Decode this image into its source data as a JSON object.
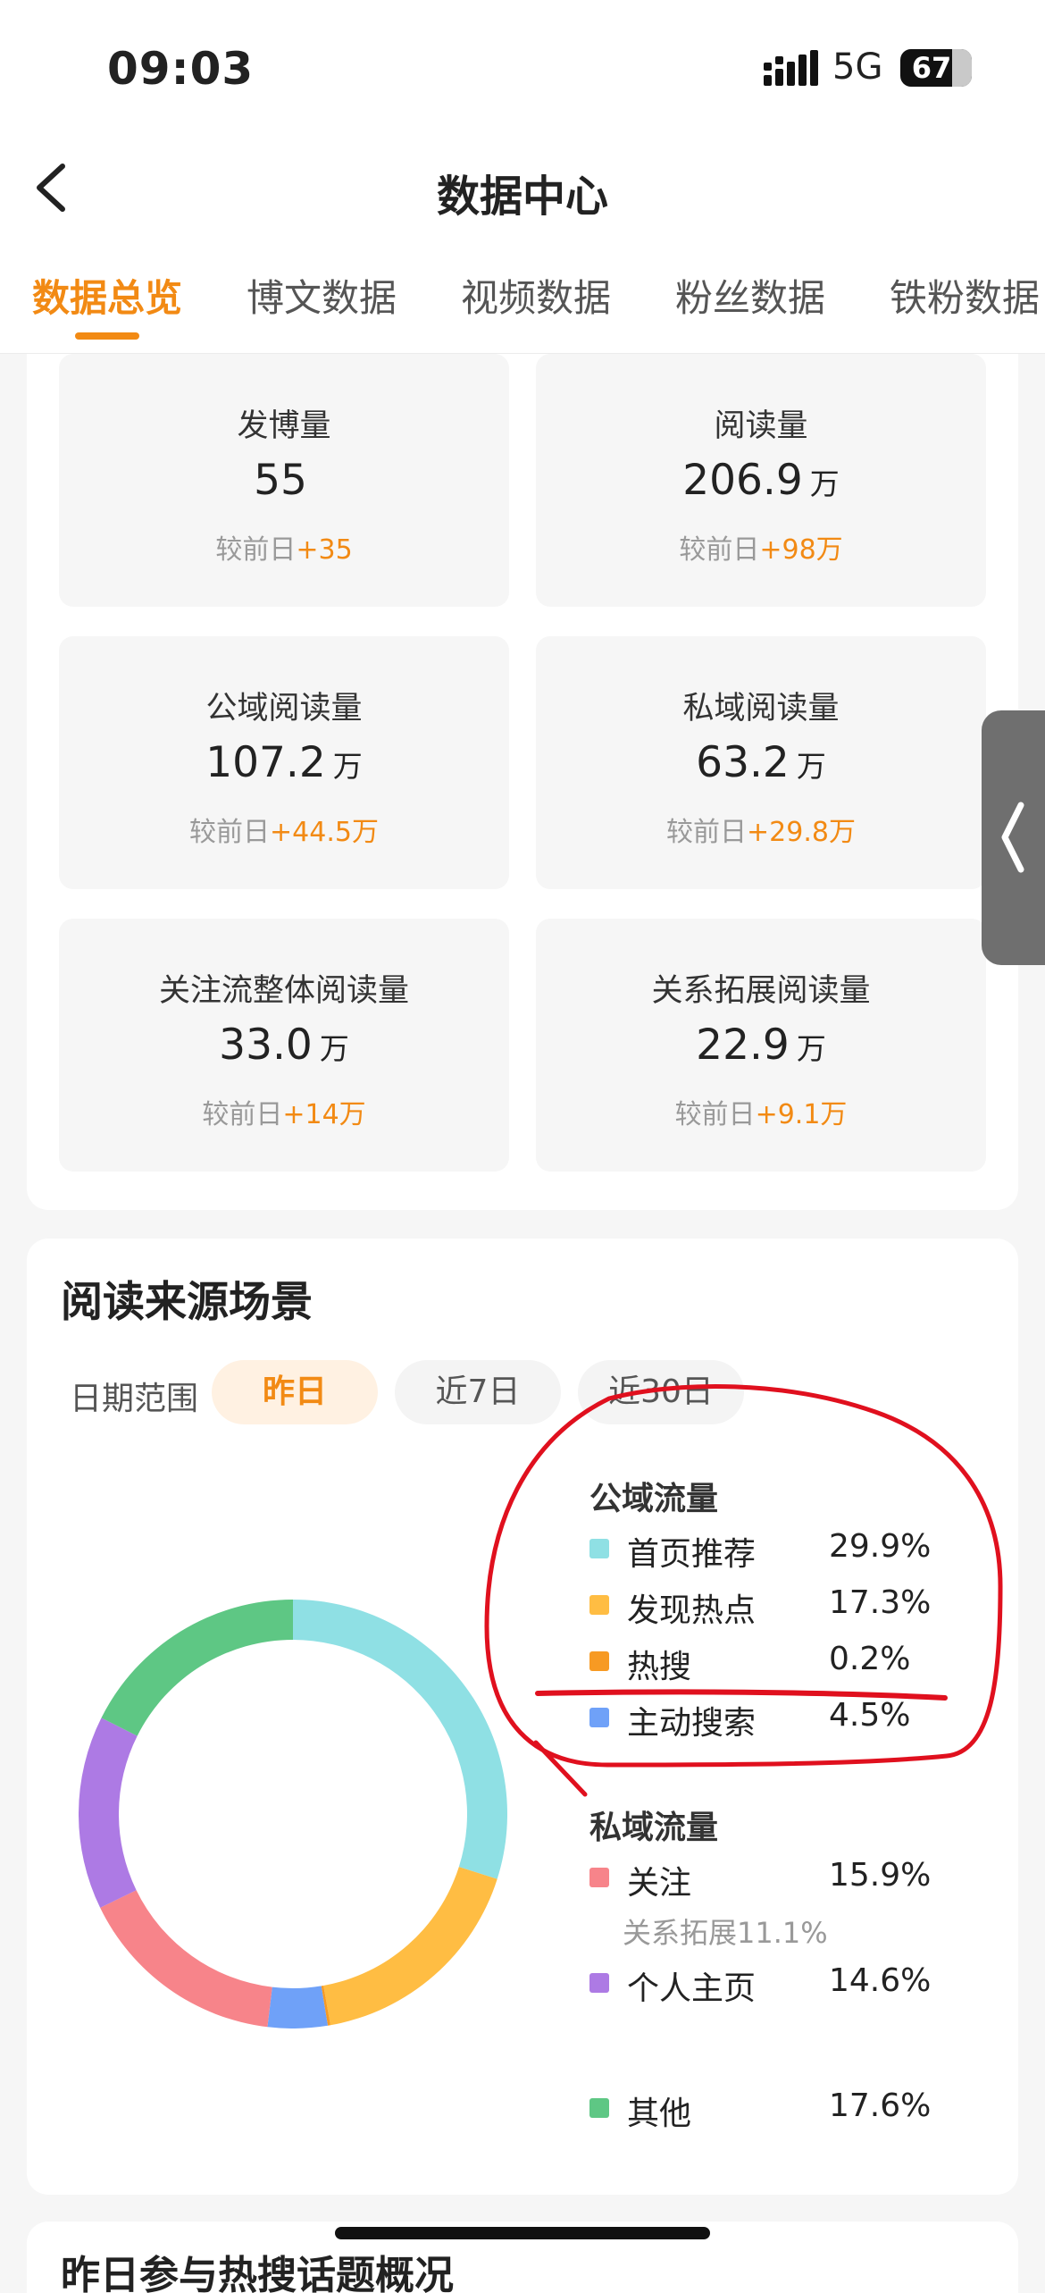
{
  "status_bar": {
    "time": "09:03",
    "network": "5G",
    "battery": "67"
  },
  "header": {
    "title": "数据中心",
    "tabs": [
      {
        "label": "数据总览",
        "active": true
      },
      {
        "label": "博文数据",
        "active": false
      },
      {
        "label": "视频数据",
        "active": false
      },
      {
        "label": "粉丝数据",
        "active": false
      },
      {
        "label": "铁粉数据",
        "active": false
      }
    ]
  },
  "stats": [
    {
      "label": "发博量",
      "value": "55",
      "unit": "",
      "delta_prefix": "较前日",
      "delta": "+35"
    },
    {
      "label": "阅读量",
      "value": "206.9",
      "unit": "万",
      "delta_prefix": "较前日",
      "delta": "+98万"
    },
    {
      "label": "公域阅读量",
      "value": "107.2",
      "unit": "万",
      "delta_prefix": "较前日",
      "delta": "+44.5万"
    },
    {
      "label": "私域阅读量",
      "value": "63.2",
      "unit": "万",
      "delta_prefix": "较前日",
      "delta": "+29.8万"
    },
    {
      "label": "关注流整体阅读量",
      "value": "33.0",
      "unit": "万",
      "delta_prefix": "较前日",
      "delta": "+14万"
    },
    {
      "label": "关系拓展阅读量",
      "value": "22.9",
      "unit": "万",
      "delta_prefix": "较前日",
      "delta": "+9.1万"
    }
  ],
  "read_source": {
    "title": "阅读来源场景",
    "date_range_label": "日期范围",
    "ranges": [
      {
        "label": "昨日",
        "active": true
      },
      {
        "label": "近7日",
        "active": false
      },
      {
        "label": "近30日",
        "active": false
      }
    ],
    "groups": {
      "public": "公域流量",
      "private": "私域流量"
    },
    "legend": [
      {
        "name": "首页推荐",
        "percent": "29.9%",
        "color": "#8fe0e4"
      },
      {
        "name": "发现热点",
        "percent": "17.3%",
        "color": "#ffbd43"
      },
      {
        "name": "热搜",
        "percent": "0.2%",
        "color": "#f79a23"
      },
      {
        "name": "主动搜索",
        "percent": "4.5%",
        "color": "#6fa1f8"
      },
      {
        "name": "关注",
        "percent": "15.9%",
        "color": "#f7848a",
        "sub": "关系拓展11.1%"
      },
      {
        "name": "个人主页",
        "percent": "14.6%",
        "color": "#ad7ae4"
      },
      {
        "name": "其他",
        "percent": "17.6%",
        "color": "#5ec784"
      }
    ]
  },
  "chart_data": {
    "type": "pie",
    "title": "",
    "categories": [
      "首页推荐",
      "发现热点",
      "热搜",
      "主动搜索",
      "关注",
      "个人主页",
      "其他"
    ],
    "values": [
      29.9,
      17.3,
      0.2,
      4.5,
      15.9,
      14.6,
      17.6
    ],
    "colors": [
      "#8fe0e4",
      "#ffbd43",
      "#f79a23",
      "#6fa1f8",
      "#f7848a",
      "#ad7ae4",
      "#5ec784"
    ],
    "donut": true,
    "legend": "right"
  },
  "next_section": {
    "title": "昨日参与热搜话题概况"
  },
  "annotation_color": "#e0101e"
}
